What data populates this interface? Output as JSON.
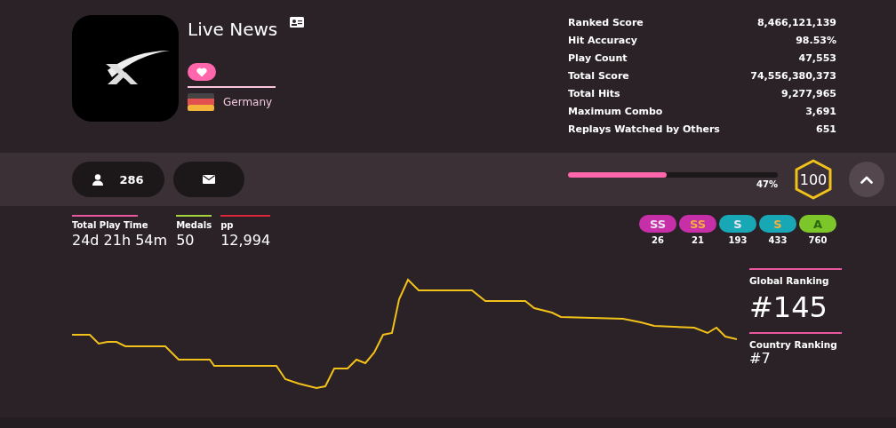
{
  "profile": {
    "username": "Live News",
    "country": "Germany",
    "supporter": true
  },
  "stats": [
    {
      "label": "Ranked Score",
      "value": "8,466,121,139"
    },
    {
      "label": "Hit Accuracy",
      "value": "98.53%"
    },
    {
      "label": "Play Count",
      "value": "47,553"
    },
    {
      "label": "Total Score",
      "value": "74,556,380,373"
    },
    {
      "label": "Total Hits",
      "value": "9,277,965"
    },
    {
      "label": "Maximum Combo",
      "value": "3,691"
    },
    {
      "label": "Replays Watched by Others",
      "value": "651"
    }
  ],
  "followers": "286",
  "level_progress": {
    "level": 0.47,
    "reading": "47%"
  },
  "level": "100",
  "summary": [
    {
      "label": "Total Play Time",
      "value": "24d 21h 54m",
      "color": "#e9589e"
    },
    {
      "label": "Medals",
      "value": "50",
      "color": "#a5d33a"
    },
    {
      "label": "pp",
      "value": "12,994",
      "color": "#d9263a"
    }
  ],
  "grades": [
    {
      "letter": "SS",
      "kind": "silver",
      "color": "#c62fa8",
      "count": "26"
    },
    {
      "letter": "SS",
      "kind": "gold",
      "color": "#c62fa8",
      "count": "21"
    },
    {
      "letter": "S",
      "kind": "silver",
      "color": "#18a7b5",
      "count": "193"
    },
    {
      "letter": "S",
      "kind": "gold",
      "color": "#18a7b5",
      "count": "433"
    },
    {
      "letter": "A",
      "kind": "plain",
      "color": "#7cc62a",
      "count": "760"
    }
  ],
  "rankings": [
    {
      "label": "Global Ranking",
      "value": "#145",
      "kind": "large"
    },
    {
      "label": "Country Ranking",
      "value": "#7",
      "kind": "small"
    }
  ]
}
